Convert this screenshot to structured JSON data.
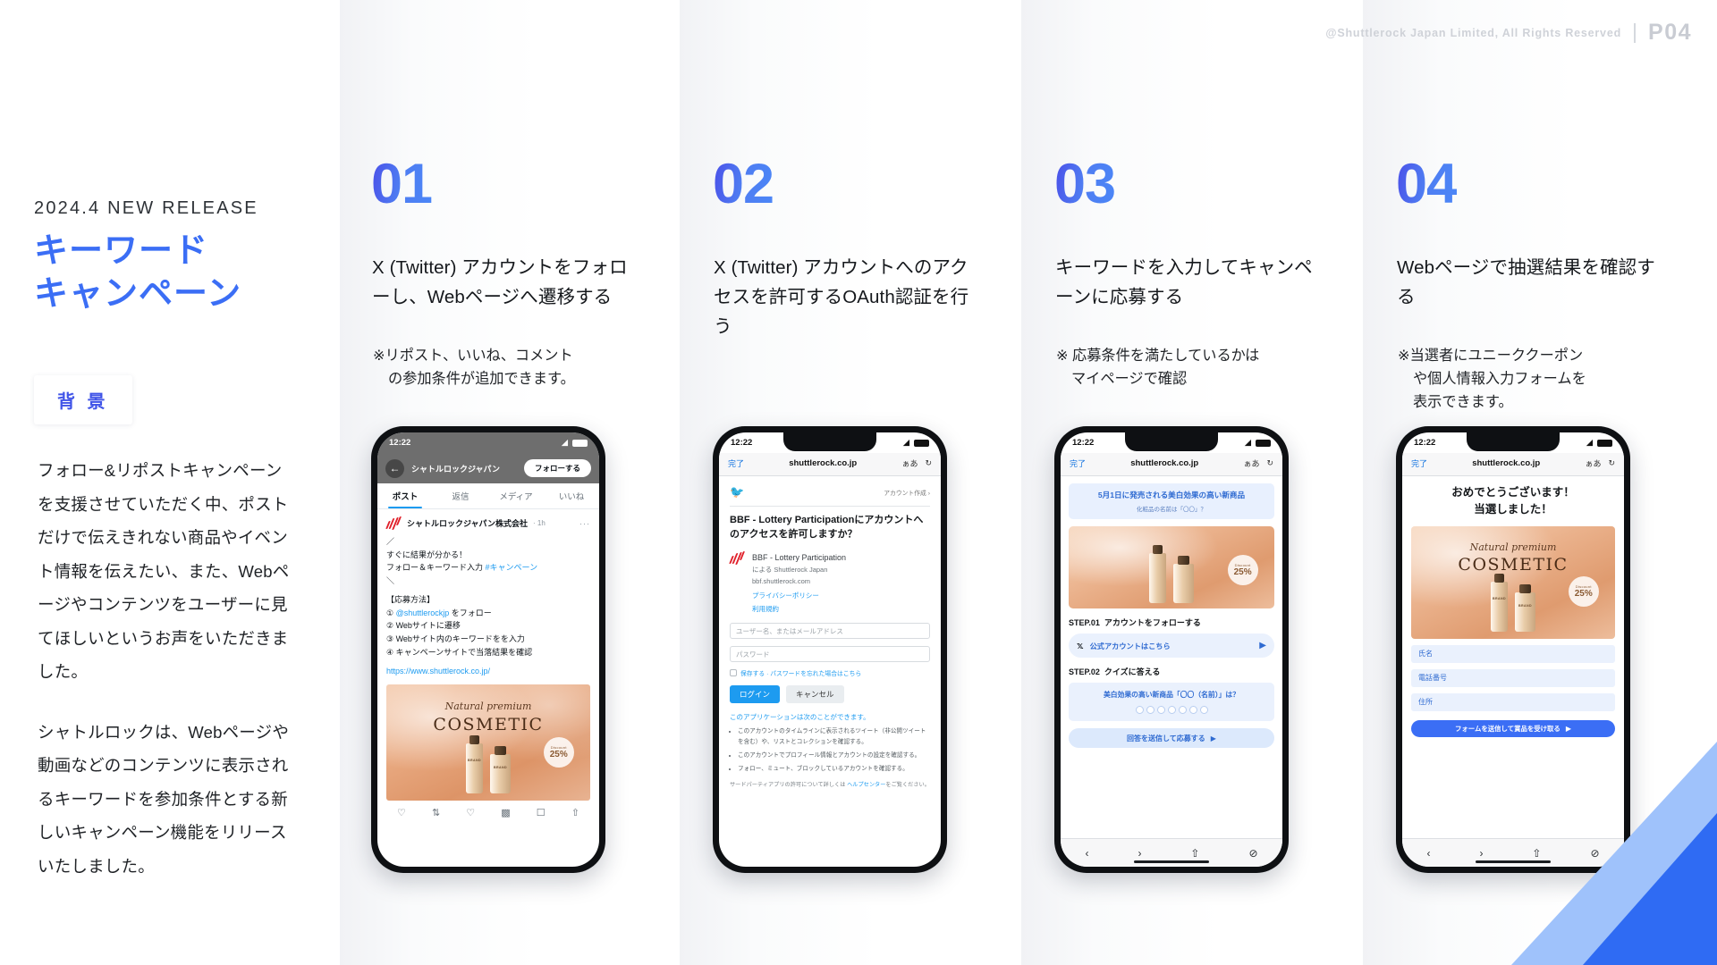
{
  "header": {
    "copyright": "@Shuttlerock Japan Limited, All Rights Reserved",
    "page_number": "P04"
  },
  "intro": {
    "eyebrow": "2024.4 NEW RELEASE",
    "title_line1": "キーワード",
    "title_line2": "キャンペーン",
    "badge": "背 景",
    "paragraph1": "フォロー&リポストキャンペーンを支援させていただく中、ポストだけで伝えきれない商品やイベント情報を伝えたい、また、Webページやコンテンツをユーザーに見てほしいというお声をいただきました。",
    "paragraph2": "シャトルロックは、Webページや動画などのコンテンツに表示されるキーワードを参加条件とする新しいキャンペーン機能をリリースいたしました。"
  },
  "steps": [
    {
      "number": "01",
      "title": "X (Twitter) アカウントをフォローし、Webページへ遷移する",
      "note_line1": "※リポスト、いいね、コメント",
      "note_line2": "の参加条件が追加できます。"
    },
    {
      "number": "02",
      "title": "X (Twitter) アカウントへのアクセスを許可するOAuth認証を行う",
      "note_line1": "",
      "note_line2": ""
    },
    {
      "number": "03",
      "title": "キーワードを入力してキャンペーンに応募する",
      "note_line1": "※ 応募条件を満たしているかは",
      "note_line2": "マイページで確認"
    },
    {
      "number": "04",
      "title": "Webページで抽選結果を確認する",
      "note_line1": "※当選者にユニーククーポン",
      "note_line2": "や個人情報入力フォームを",
      "note_line3": "表示できます。"
    }
  ],
  "phone1": {
    "time": "12:22",
    "handle": "シャトルロックジャパン",
    "follow_button": "フォローする",
    "tabs": [
      "ポスト",
      "返信",
      "メディア",
      "いいね"
    ],
    "active_tab": "ポスト",
    "account_name": "シャトルロックジャパン株式会社",
    "timestamp": "1h",
    "post_line1": "／",
    "post_line2": "すぐに結果が分かる！",
    "post_line3": "フォロー＆キーワード入力 ",
    "post_hashtag": "#キャンペーン",
    "post_line4": "＼",
    "apply_header": "【応募方法】",
    "apply_1_link": "@shuttlerockjp",
    "apply_1_rest": " をフォロー",
    "apply_2": "② Webサイトに遷移",
    "apply_3": "③ Webサイト内のキーワードをを入力",
    "apply_4": "④ キャンペーンサイトで当落結果を確認",
    "url": "https://www.shuttlerock.co.jp/",
    "image_script": "Natural premium",
    "image_title": "COSMETIC",
    "discount_label": "Discount",
    "discount_value": "25%",
    "brand_label": "BRAND"
  },
  "phone2": {
    "time": "12:22",
    "done": "完了",
    "url": "shuttlerock.co.jp",
    "text_size": "ぁあ",
    "create_account": "アカウント作成 ›",
    "question": "BBF - Lottery Participationにアカウントへのアクセスを許可しますか？",
    "app_name": "BBF - Lottery Participation",
    "app_by": "による Shuttlerock Japan",
    "app_domain": "bbf.shuttlerock.com",
    "privacy": "プライバシーポリシー",
    "terms": "利用規約",
    "input_user_placeholder": "ユーザー名、またはメールアドレス",
    "input_pass_placeholder": "パスワード",
    "remember": "保存する · パスワードを忘れた場合はこちら",
    "login_button": "ログイン",
    "cancel_button": "キャンセル",
    "perm_header": "このアプリケーションは次のことができます。",
    "perms": [
      "このアカウントのタイムラインに表示されるツイート（非公開ツイートを含む）や、リストとコレクションを確認する。",
      "このアカウントでプロフィール情報とアカウントの設定を確認する。",
      "フォロー、ミュート、ブロックしているアカウントを確認する。"
    ],
    "footer_1": "サードパーティアプリの許可について詳しくは ",
    "footer_link": "ヘルプセンター",
    "footer_2": "をご覧ください。"
  },
  "phone3": {
    "time": "12:22",
    "done": "完了",
    "url": "shuttlerock.co.jp",
    "text_size": "ぁあ",
    "hero_title": "5月1日に発売される美白効果の高い新商品",
    "hero_sub": "化粧品の名前は「〇〇」？",
    "step1_label": "STEP.01",
    "step1_text": "アカウントをフォローする",
    "cta_text": "公式アカウントはこちら",
    "step2_label": "STEP.02",
    "step2_text": "クイズに答える",
    "quiz_question": "美白効果の高い新商品「〇〇（名前）」は？",
    "submit_text": "回答を送信して応募する",
    "keyword_dots": 7
  },
  "phone4": {
    "time": "12:22",
    "done": "完了",
    "url": "shuttlerock.co.jp",
    "text_size": "ぁあ",
    "win_line1": "おめでとうございます！",
    "win_line2": "当選しました！",
    "image_script": "Natural premium",
    "image_title": "COSMETIC",
    "discount_label": "Discount",
    "discount_value": "25%",
    "field_name": "氏名",
    "field_phone": "電話番号",
    "field_address": "住所",
    "submit": "フォームを送信して賞品を受け取る"
  },
  "colors": {
    "accent_blue": "#3b6ef5",
    "badge_blue": "#4155e8",
    "twitter_blue": "#1d9bf0",
    "panel_gray": "#f1f2f5"
  }
}
